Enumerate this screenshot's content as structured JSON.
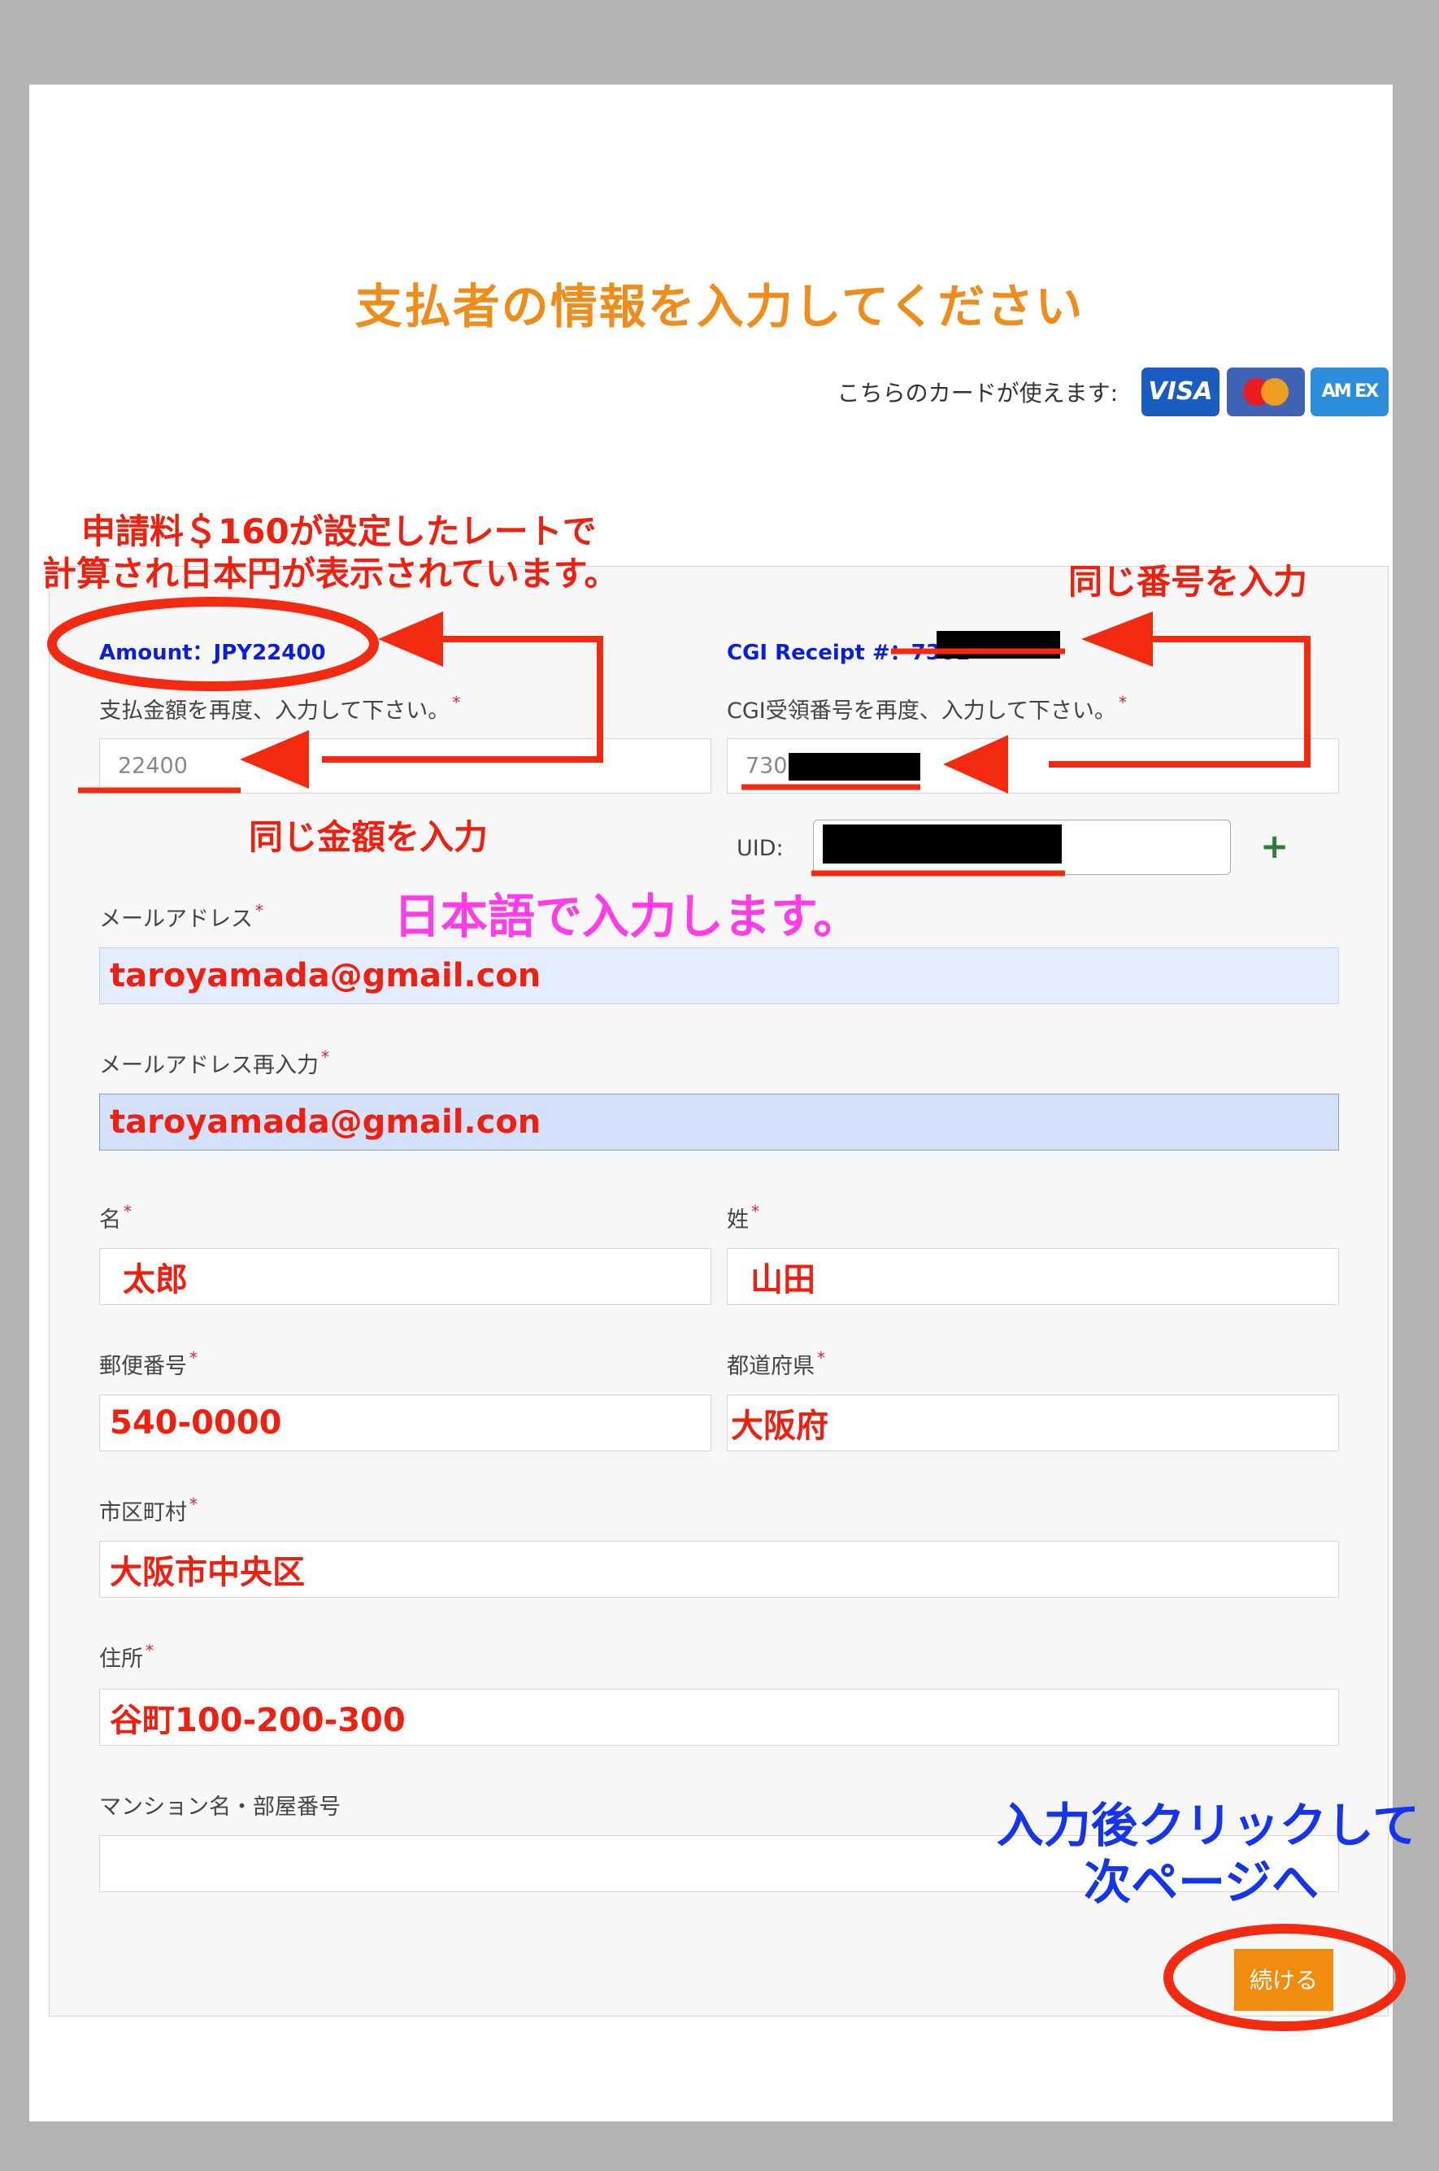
{
  "header": {
    "title": "支払者の情報を入力してください",
    "cards_label": "こちらのカードが使えます:",
    "cards": [
      {
        "name": "visa",
        "label": "VISA",
        "color": "#1a5cbf"
      },
      {
        "name": "mastercard",
        "label": "",
        "color": "#3f64b5"
      },
      {
        "name": "amex",
        "label": "AM EX",
        "color": "#2c8fde"
      }
    ]
  },
  "form": {
    "amount_label": "Amount：JPY22400",
    "amount_reenter_label": "支払金額を再度、入力して下さい。",
    "amount_value": "22400",
    "receipt_label": "CGI Receipt #：7301",
    "receipt_reenter_label": "CGI受領番号を再度、入力して下さい。",
    "receipt_value": "730",
    "uid_label": "UID:",
    "email_label": "メールアドレス",
    "email_value": "taroyamada@gmail.con",
    "email_confirm_label": "メールアドレス再入力",
    "email_confirm_value": "taroyamada@gmail.con",
    "first_name_label": "名",
    "first_name_value": "太郎",
    "last_name_label": "姓",
    "last_name_value": "山田",
    "postal_label": "郵便番号",
    "postal_value": "540-0000",
    "prefecture_label": "都道府県",
    "prefecture_value": "大阪府",
    "city_label": "市区町村",
    "city_value": "大阪市中央区",
    "address_label": "住所",
    "address_value": "谷町100-200-300",
    "building_label": "マンション名・部屋番号",
    "building_value": "",
    "required_mark": "*",
    "plus_symbol": "+",
    "continue_label": "続ける"
  },
  "annotations": {
    "rate_line1": "申請料＄160が設定したレートで",
    "rate_line2": "計算され日本円が表示されています。",
    "same_number": "同じ番号を入力",
    "same_amount": "同じ金額を入力",
    "japanese_input": "日本語で入力します。",
    "click_line1": "入力後クリックして",
    "click_line2": "次ページへ",
    "annotation_red": "#f02010",
    "annotation_magenta": "#ff3ce8",
    "annotation_blue": "#1434ee"
  }
}
